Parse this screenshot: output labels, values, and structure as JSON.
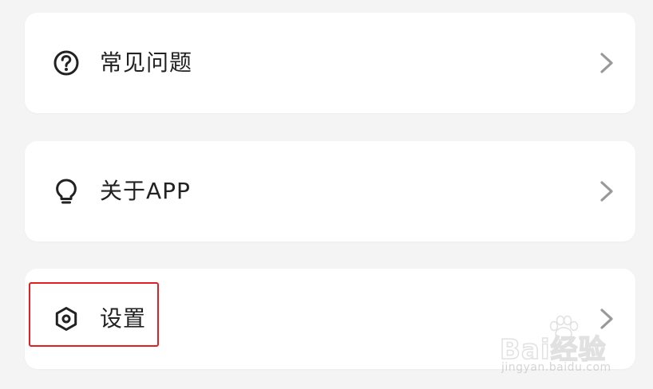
{
  "menu": {
    "items": [
      {
        "label": "常见问题",
        "icon": "help-circle-icon"
      },
      {
        "label": "关于APP",
        "icon": "lightbulb-icon"
      },
      {
        "label": "设置",
        "icon": "settings-hexagon-icon"
      }
    ]
  },
  "annotation": {
    "highlight_color": "#e02020"
  },
  "watermark": {
    "brand": "Bai经验",
    "url": "jingyan.baidu.com"
  },
  "colors": {
    "background": "#f4f4f4",
    "card": "#ffffff",
    "text": "#222222",
    "chevron": "#999999"
  }
}
